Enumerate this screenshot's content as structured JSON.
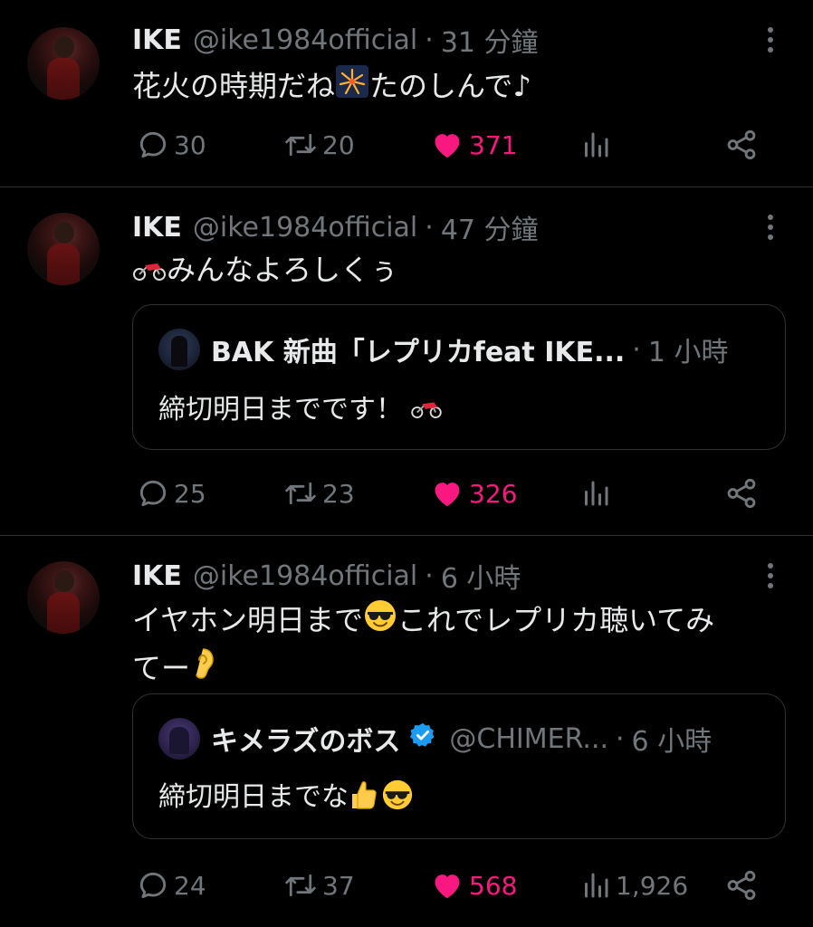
{
  "tweets": [
    {
      "name": "IKE",
      "handle": "@ike1984official",
      "separator": "·",
      "time": "31 分鐘",
      "text_parts": [
        "花火の時期だね",
        "たのしんで♪"
      ],
      "replies": "30",
      "retweets": "20",
      "likes": "371",
      "views": ""
    },
    {
      "name": "IKE",
      "handle": "@ike1984official",
      "separator": "·",
      "time": "47 分鐘",
      "text_parts": [
        "みんなよろしくぅ"
      ],
      "quote": {
        "name": "BAK 新曲「レプリカfeat IKE...",
        "handle": "",
        "separator": "·",
        "time": "1 小時",
        "text": "締切明日までです！"
      },
      "replies": "25",
      "retweets": "23",
      "likes": "326",
      "views": ""
    },
    {
      "name": "IKE",
      "handle": "@ike1984official",
      "separator": "·",
      "time": "6 小時",
      "text_parts": [
        "イヤホン明日まで",
        "これでレプリカ聴いてみ",
        "てー"
      ],
      "quote": {
        "name": "キメラズのボス",
        "handle": "@CHIMER...",
        "separator": "·",
        "time": "6 小時",
        "text": "締切明日までな"
      },
      "replies": "24",
      "retweets": "37",
      "likes": "568",
      "views": "1,926"
    }
  ],
  "icons": {
    "reply": "reply-icon",
    "retweet": "retweet-icon",
    "like": "heart-icon",
    "views": "views-icon",
    "share": "share-icon",
    "more": "more-icon",
    "verified": "verified-badge-icon"
  },
  "colors": {
    "background": "#000000",
    "text_primary": "#e7e9ea",
    "text_secondary": "#71767b",
    "like_accent": "#f91880",
    "border": "#2f3336",
    "verified": "#1d9bf0"
  }
}
